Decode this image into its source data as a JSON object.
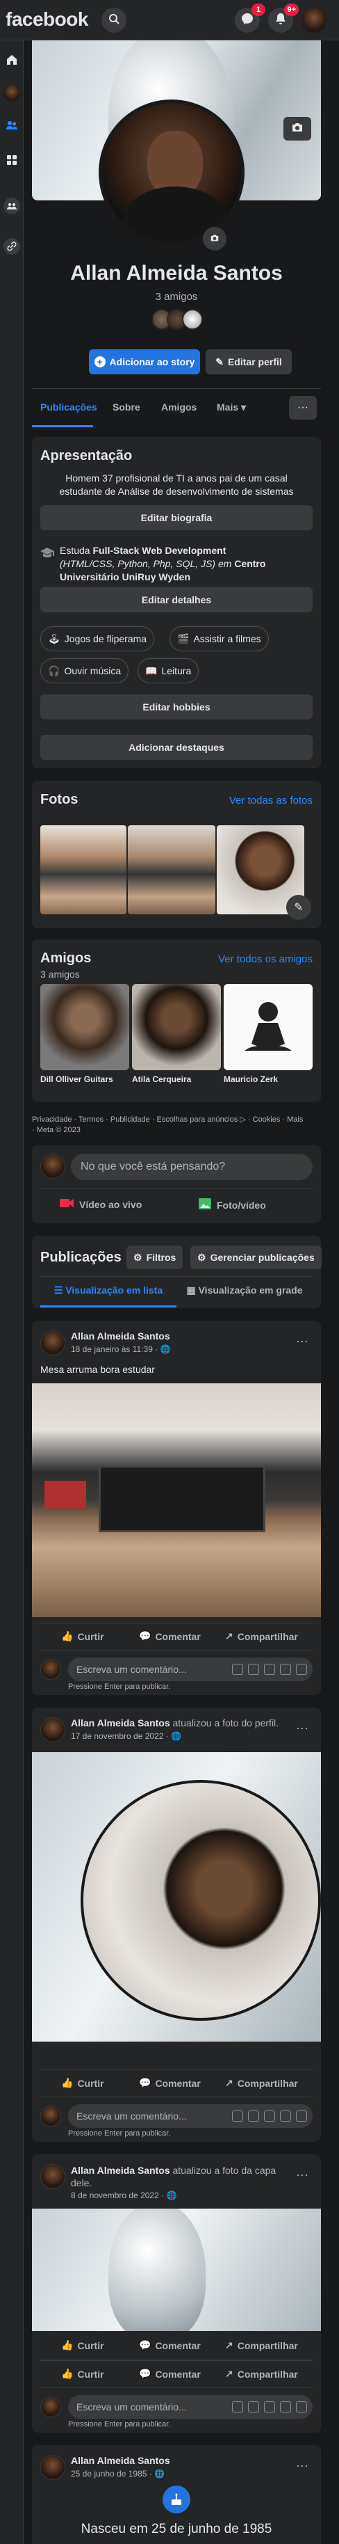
{
  "topbar": {
    "logo": "facebook",
    "messenger_badge": "1",
    "notifications_badge": "9+"
  },
  "profile": {
    "name": "Allan Almeida Santos",
    "friends_count": "3 amigos",
    "add_story": "Adicionar ao story",
    "edit_profile": "Editar perfil"
  },
  "tabs": [
    "Publicações",
    "Sobre",
    "Amigos",
    "Mais"
  ],
  "intro": {
    "title": "Apresentação",
    "bio_line1": "Homem 37 profisional de TI a anos pai de um casal",
    "bio_line2": "estudante de Análise de desenvolvimento de sistemas",
    "edit_bio": "Editar biografia",
    "study_prefix": "Estuda ",
    "study_course": "Full-Stack Web Development",
    "study_line2": "(HTML/CSS, Python, Php, SQL, JS) em ",
    "study_school": "Centro Universitário UniRuy Wyden",
    "edit_details": "Editar detalhes",
    "hobbies": [
      "Jogos de fliperama",
      "Assistir a filmes",
      "Ouvir música",
      "Leitura"
    ],
    "edit_hobbies": "Editar hobbies",
    "add_featured": "Adicionar destaques"
  },
  "photos": {
    "title": "Fotos",
    "see_all": "Ver todas as fotos"
  },
  "friends": {
    "title": "Amigos",
    "count": "3 amigos",
    "see_all": "Ver todos os amigos",
    "list": [
      "Dill Olliver Guitars",
      "Atila Cerqueira",
      "Mauricio Zerk"
    ]
  },
  "footer": {
    "line1": "Privacidade · Termos · Publicidade · Escolhas para anúncios ▷ · Cookies · Mais",
    "line2": "· Meta © 2023"
  },
  "composer": {
    "placeholder": "No que você está pensando?",
    "live_video": "Vídeo ao vivo",
    "photo_video": "Foto/vídeo"
  },
  "posts_header": {
    "title": "Publicações",
    "filters": "Filtros",
    "manage": "Gerenciar publicações",
    "list_view": "Visualização em lista",
    "grid_view": "Visualização em grade"
  },
  "post_actions": {
    "like": "Curtir",
    "comment": "Comentar",
    "share": "Compartilhar",
    "write_comment": "Escreva um comentário...",
    "press_enter": "Pressione Enter para publicar."
  },
  "posts": [
    {
      "author": "Allan Almeida Santos",
      "suffix": "",
      "date": "18 de janeiro às 11:39 · ",
      "text": "Mesa arruma bora estudar"
    },
    {
      "author": "Allan Almeida Santos",
      "suffix": " atualizou a foto do perfil.",
      "date": "17 de novembro de 2022 · ",
      "text": ""
    },
    {
      "author": "Allan Almeida Santos",
      "suffix": " atualizou a foto da capa",
      "suffix2": "dele.",
      "date": "8 de novembro de 2022 · ",
      "text": ""
    },
    {
      "author": "Allan Almeida Santos",
      "suffix": "",
      "date": "25 de junho de 1985 · ",
      "text": "Nasceu em 25 de junho de 1985"
    }
  ]
}
